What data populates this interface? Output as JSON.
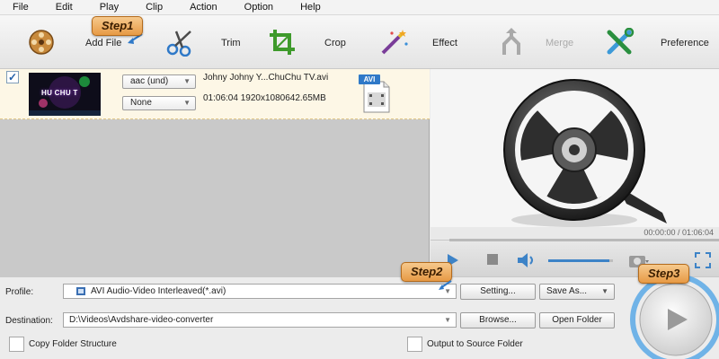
{
  "menu": [
    "File",
    "Edit",
    "Play",
    "Clip",
    "Action",
    "Option",
    "Help"
  ],
  "toolbar": {
    "add_file": "Add File",
    "trim": "Trim",
    "crop": "Crop",
    "effect": "Effect",
    "merge": "Merge",
    "preference": "Preference"
  },
  "steps": {
    "step1": "Step1",
    "step2": "Step2",
    "step3": "Step3"
  },
  "file": {
    "checked": true,
    "thumbnail_text": "HU CHU T",
    "audio_track": "aac (und)",
    "subtitle": "None",
    "name": "Johny Johny Y...ChuChu TV.avi",
    "meta": "01:06:04 1920x1080642.65MB",
    "format_badge": "AVI"
  },
  "player": {
    "time": "00:00:00 / 01:06:04",
    "volume_fraction": 0.95
  },
  "output": {
    "profile_label": "Profile:",
    "profile_value": "AVI Audio-Video Interleaved(*.avi)",
    "settings_button": "Setting...",
    "save_as_button": "Save As...",
    "destination_label": "Destination:",
    "destination_value": "D:\\Videos\\Avdshare-video-converter",
    "browse_button": "Browse...",
    "open_folder_button": "Open Folder",
    "copy_folder_label": "Copy Folder Structure",
    "output_source_label": "Output to Source Folder"
  },
  "colors": {
    "step_badge": "#e79a45",
    "file_row_bg": "#fdf7e6",
    "convert_ring": "#5aa9e6",
    "accent_blue": "#2f79c8"
  }
}
